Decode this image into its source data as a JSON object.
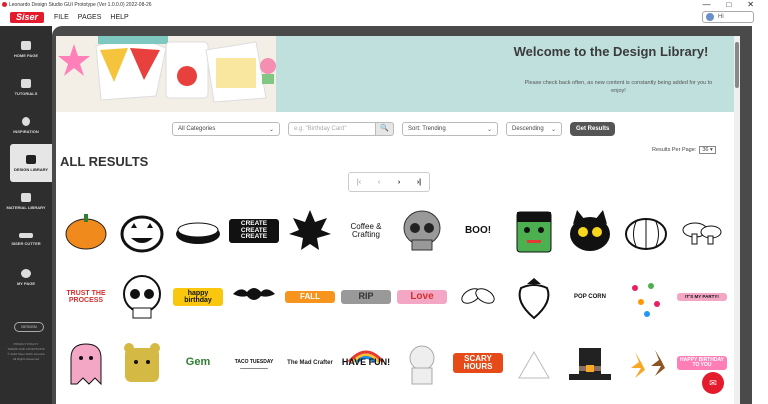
{
  "window": {
    "title": "Leonardo Design Studio GUI Prototype (Ver 1.0.0.0) 2022-08-26",
    "controls": [
      "—",
      "□",
      "✕"
    ]
  },
  "menubar": {
    "logo": "Siser",
    "items": [
      "FILE",
      "PAGES",
      "HELP"
    ],
    "user_label": "Hi"
  },
  "sidebar": {
    "items": [
      {
        "label": "HOME PAGE",
        "icon": "home-icon"
      },
      {
        "label": "TUTORIALS",
        "icon": "video-icon"
      },
      {
        "label": "INSPIRATION",
        "icon": "lightbulb-icon"
      },
      {
        "label": "DESIGN LIBRARY",
        "icon": "library-icon",
        "active": true
      },
      {
        "label": "MATERIAL LIBRARY",
        "icon": "material-icon"
      },
      {
        "label": "SISER CUTTER",
        "icon": "cutter-icon"
      },
      {
        "label": "MY PAGE",
        "icon": "user-icon"
      }
    ],
    "design_button": "DESIGN",
    "footer": [
      "PRIVACY POLICY",
      "TERMS AND CONDITIONS",
      "© 2022 Siser North America",
      "All Rights Reserved"
    ]
  },
  "banner": {
    "title": "Welcome to the Design Library!",
    "subtitle": "Please check back often, as new content is constantly being added for you to enjoy!"
  },
  "filters": {
    "category": "All Categories",
    "search_placeholder": "e.g. \"Birthday Card\"",
    "search_button": "🔍",
    "sort": "Sort: Trending",
    "order": "Descending",
    "get_results": "Get Results"
  },
  "results": {
    "heading": "ALL RESULTS",
    "per_page_label": "Results Per Page:",
    "per_page_value": "36 ▾",
    "pager": [
      "|‹",
      "‹",
      "›",
      "›|"
    ]
  },
  "designs": [
    {
      "name": "pumpkin",
      "text": ""
    },
    {
      "name": "jack-o-lantern",
      "text": ""
    },
    {
      "name": "pie",
      "text": ""
    },
    {
      "name": "create-create-create",
      "text": "CREATE CREATE CREATE"
    },
    {
      "name": "maple-leaf",
      "text": ""
    },
    {
      "name": "coffee-crafting",
      "text": "Coffee & Crafting"
    },
    {
      "name": "skull",
      "text": ""
    },
    {
      "name": "boo-cat",
      "text": "BOO!"
    },
    {
      "name": "frankenstein",
      "text": ""
    },
    {
      "name": "black-cat",
      "text": ""
    },
    {
      "name": "pumpkin-outline",
      "text": ""
    },
    {
      "name": "mushrooms",
      "text": ""
    },
    {
      "name": "trust-the-process",
      "text": "TRUST THE PROCESS"
    },
    {
      "name": "anatomical-skull",
      "text": ""
    },
    {
      "name": "happy-birthday",
      "text": "happy birthday"
    },
    {
      "name": "bats",
      "text": ""
    },
    {
      "name": "fall",
      "text": "FALL"
    },
    {
      "name": "rip-tombstone",
      "text": "RIP"
    },
    {
      "name": "love",
      "text": "Love"
    },
    {
      "name": "leaves",
      "text": ""
    },
    {
      "name": "strawberry",
      "text": ""
    },
    {
      "name": "popcorn",
      "text": "POP CORN"
    },
    {
      "name": "floral-pattern",
      "text": ""
    },
    {
      "name": "its-my-party-cake",
      "text": "IT'S MY PARTY!"
    },
    {
      "name": "ghost",
      "text": ""
    },
    {
      "name": "bear-face",
      "text": ""
    },
    {
      "name": "youre-a-gem",
      "text": "Gem"
    },
    {
      "name": "taco-tuesday",
      "text": "TACO TUESDAY"
    },
    {
      "name": "the-mad-crafter",
      "text": "The Mad Crafter"
    },
    {
      "name": "have-fun-rainbow",
      "text": "HAVE FUN!"
    },
    {
      "name": "astronaut",
      "text": ""
    },
    {
      "name": "scary-hours",
      "text": "SCARY HOURS"
    },
    {
      "name": "camping",
      "text": ""
    },
    {
      "name": "pilgrim-hat",
      "text": ""
    },
    {
      "name": "autumn-leaves",
      "text": ""
    },
    {
      "name": "happy-birthday-to-you",
      "text": "HAPPY BIRTHDAY TO YOU"
    }
  ],
  "colors": {
    "accent": "#e31b2d",
    "banner_bg": "#bfe0dc",
    "sidebar_bg": "#2e2e2e"
  }
}
